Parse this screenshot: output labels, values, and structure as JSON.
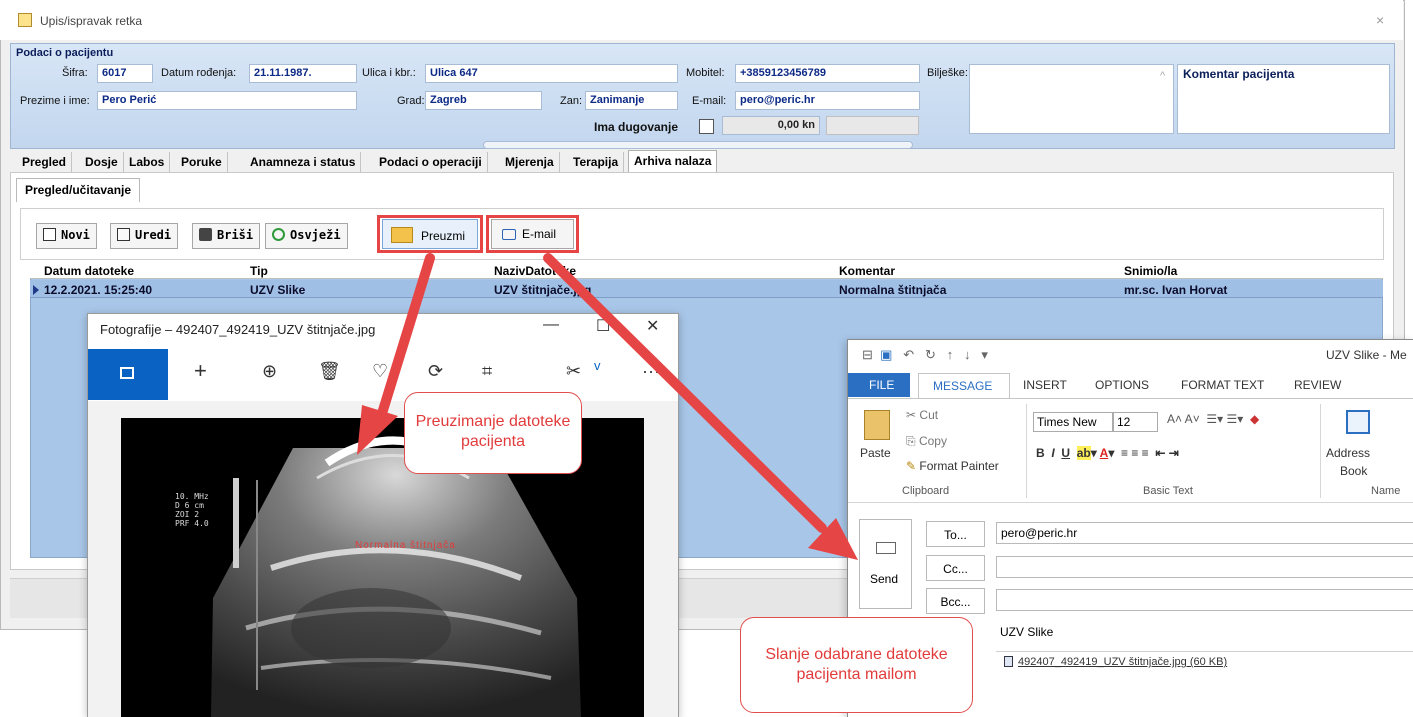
{
  "dialog": {
    "title": "Upis/ispravak retka",
    "close": "×"
  },
  "patient": {
    "header": "Podaci o pacijentu",
    "sifra_label": "Šifra:",
    "sifra": "6017",
    "dob_label": "Datum rođenja:",
    "dob": "21.11.1987.",
    "street_label": "Ulica i kbr.:",
    "street": "Ulica 647",
    "mobile_label": "Mobitel:",
    "mobile": "+3859123456789",
    "notes_label": "Bilješke:",
    "comment_title": "Komentar pacijenta",
    "name_label": "Prezime i ime:",
    "name": "Pero Perić",
    "city_label": "Grad:",
    "city": "Zagreb",
    "occupation_label": "Zan:",
    "occupation": "Zanimanje",
    "email_label": "E-mail:",
    "email": "pero@peric.hr",
    "debt_label": "Ima dugovanje",
    "debt_amount": "0,00 kn"
  },
  "tabs": [
    "Pregled",
    "Dosje",
    "Labos",
    "Poruke",
    "Anamneza i status",
    "Podaci o operaciji",
    "Mjerenja",
    "Terapija",
    "Arhiva nalaza"
  ],
  "active_tab": "Arhiva nalaza",
  "subtab": "Pregled/učitavanje",
  "toolbar": {
    "novi": "Novi",
    "uredi": "Uredi",
    "brisi": "Briši",
    "osvjezi": "Osvježi",
    "preuzmi": "Preuzmi",
    "email": "E-mail"
  },
  "grid": {
    "columns": [
      "Datum datoteke",
      "Tip",
      "NazivDatoteke",
      "Komentar",
      "Snimio/la"
    ],
    "rows": [
      [
        "12.2.2021. 15:25:40",
        "UZV Slike",
        "UZV štitnjače.jpg",
        "Normalna štitnjača",
        "mr.sc. Ivan Horvat"
      ]
    ]
  },
  "photos": {
    "title": "Fotografije – 492407_492419_UZV štitnjače.jpg",
    "minimize": "—",
    "maximize": "☐",
    "close": "✕",
    "image_text": {
      "params": [
        "10. MHz",
        "D 6 cm",
        "ZOI 2",
        "PRF 4.0"
      ],
      "annotation": "Normalna štitnjača"
    }
  },
  "outlook": {
    "title": "UZV Slike - Me",
    "tabs": [
      "FILE",
      "MESSAGE",
      "INSERT",
      "OPTIONS",
      "FORMAT TEXT",
      "REVIEW"
    ],
    "clipboard": {
      "cut": "Cut",
      "copy": "Copy",
      "paste": "Paste",
      "format_painter": "Format Painter",
      "group": "Clipboard"
    },
    "basic_text": {
      "font": "Times New",
      "size": "12",
      "group": "Basic Text"
    },
    "names": {
      "address_line1": "Address",
      "address_line2": "Book",
      "group": "Name"
    },
    "send": "Send",
    "to_label": "To...",
    "cc_label": "Cc...",
    "bcc_label": "Bcc...",
    "to": "pero@peric.hr",
    "subject": "UZV Slike",
    "attachment": "492407_492419_UZV štitnjače.jpg (60 KB)"
  },
  "callouts": {
    "download": "Preuzimanje datoteke pacijenta",
    "email": "Slanje odabrane datoteke pacijenta mailom"
  },
  "colors": {
    "highlight": "#e64545",
    "accent": "#0a63c2",
    "outlook_blue": "#2b6fc2",
    "grid_row": "#9fbfe5"
  }
}
